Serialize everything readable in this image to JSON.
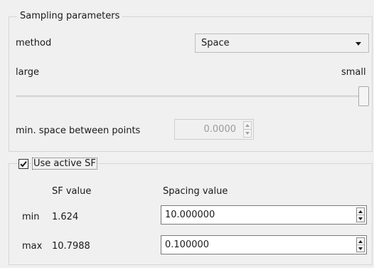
{
  "sampling": {
    "title": "Sampling parameters",
    "method_label": "method",
    "method_value": "Space",
    "large_label": "large",
    "small_label": "small",
    "slider_fraction": 1.0,
    "min_space_label": "min. space between points",
    "min_space_value": "0.0000"
  },
  "active_sf": {
    "checkbox_label": "Use active SF",
    "checked": true,
    "col_sf": "SF value",
    "col_spacing": "Spacing value",
    "min_label": "min",
    "min_sf": "1.624",
    "min_spacing": "10.000000",
    "max_label": "max",
    "max_sf": "10.7988",
    "max_spacing": "0.100000"
  }
}
